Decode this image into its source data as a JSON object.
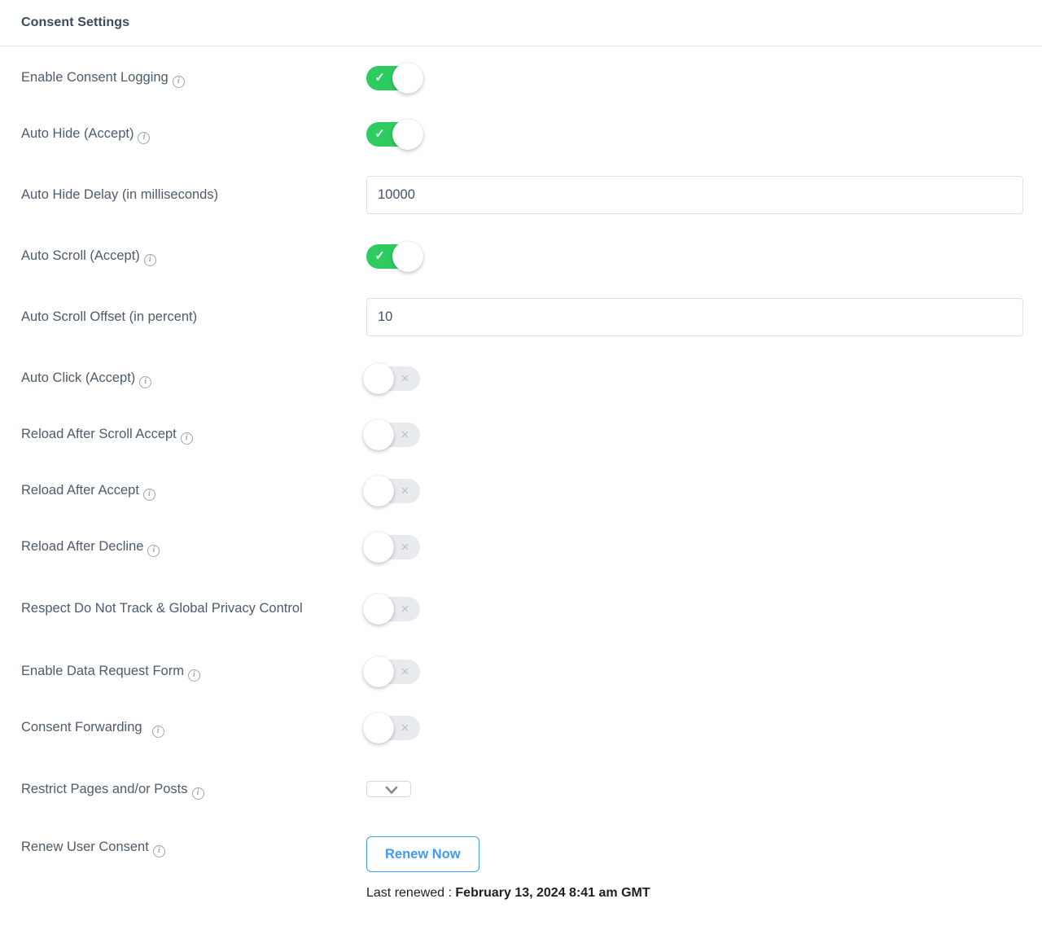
{
  "header": {
    "title": "Consent Settings"
  },
  "icons": {
    "info": "info-icon",
    "chevron_down": "chevron-down-icon",
    "check": "✓",
    "cross": "×"
  },
  "colors": {
    "toggle_on": "#2ecb5f",
    "toggle_off_track": "#e8eaed",
    "accent_link": "#3e9bfb",
    "label_text": "#4d5b6b",
    "header_text": "#3c4a5c"
  },
  "rows": [
    {
      "id": "enable-consent-logging",
      "label": "Enable Consent Logging",
      "has_info": true,
      "control": "toggle",
      "state": "on",
      "mark": "✓"
    },
    {
      "id": "auto-hide-accept",
      "label": "Auto Hide (Accept)",
      "has_info": true,
      "control": "toggle",
      "state": "on",
      "mark": "✓"
    },
    {
      "id": "auto-hide-delay",
      "label": "Auto Hide Delay (in milliseconds)",
      "has_info": false,
      "control": "input",
      "value": "10000",
      "placeholder": ""
    },
    {
      "id": "auto-scroll-accept",
      "label": "Auto Scroll (Accept)",
      "has_info": true,
      "control": "toggle",
      "state": "on",
      "mark": "✓"
    },
    {
      "id": "auto-scroll-offset",
      "label": "Auto Scroll Offset (in percent)",
      "has_info": false,
      "control": "input",
      "value": "10",
      "placeholder": ""
    },
    {
      "id": "auto-click-accept",
      "label": "Auto Click (Accept)",
      "has_info": true,
      "control": "toggle",
      "state": "off",
      "mark": "×"
    },
    {
      "id": "reload-after-scroll-accept",
      "label": "Reload After Scroll Accept",
      "has_info": true,
      "control": "toggle",
      "state": "off",
      "mark": "×"
    },
    {
      "id": "reload-after-accept",
      "label": "Reload After Accept",
      "has_info": true,
      "control": "toggle",
      "state": "off",
      "mark": "×"
    },
    {
      "id": "reload-after-decline",
      "label": "Reload After Decline",
      "has_info": true,
      "control": "toggle",
      "state": "off",
      "mark": "×"
    },
    {
      "id": "respect-do-not-track",
      "label": "Respect Do Not Track & Global Privacy Control",
      "has_info": false,
      "control": "toggle",
      "state": "off",
      "mark": "×"
    },
    {
      "id": "enable-data-request-form",
      "label": "Enable Data Request Form",
      "has_info": true,
      "control": "toggle",
      "state": "off",
      "mark": "×"
    },
    {
      "id": "consent-forwarding",
      "label": "Consent Forwarding",
      "has_info": true,
      "info_spaced": true,
      "control": "toggle",
      "state": "off",
      "mark": "×"
    },
    {
      "id": "restrict-pages-posts",
      "label": "Restrict Pages and/or Posts",
      "has_info": true,
      "control": "select",
      "selected": "",
      "placeholder": ""
    },
    {
      "id": "renew-user-consent",
      "label": "Renew User Consent",
      "has_info": true,
      "control": "renew",
      "button_label": "Renew Now",
      "last_renewed_label": "Last renewed : ",
      "last_renewed_value": "February 13, 2024 8:41 am GMT"
    }
  ]
}
